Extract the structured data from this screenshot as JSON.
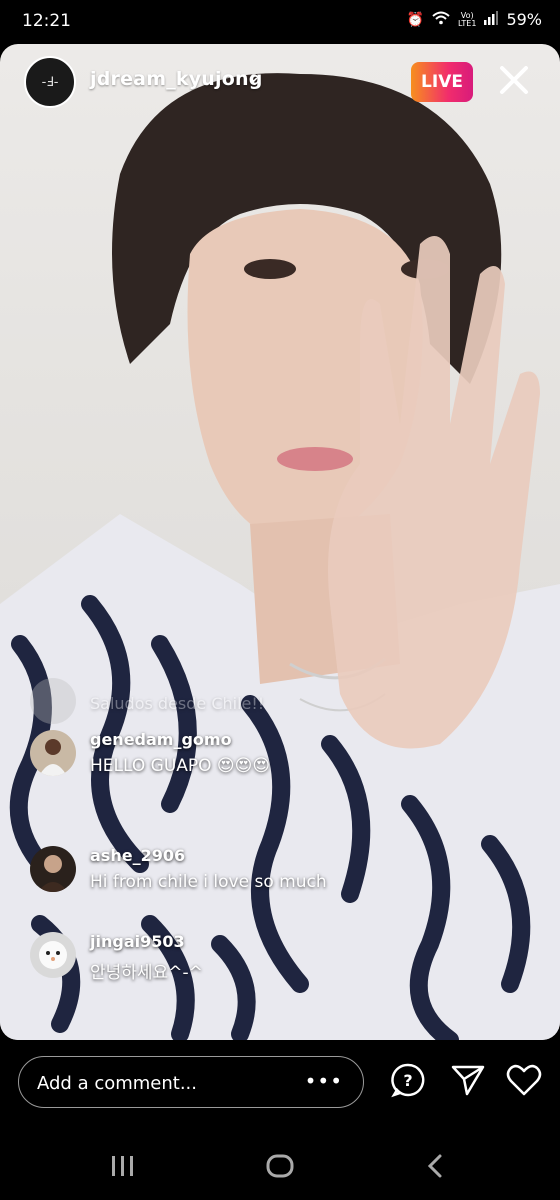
{
  "status_bar": {
    "time": "12:21",
    "network_label_top": "Vo)",
    "network_label_bottom": "LTE1",
    "battery": "59%"
  },
  "live": {
    "host_username": "jdream_kyujong",
    "badge": "LIVE"
  },
  "comments": [
    {
      "username": "",
      "text": "Saludos desde Chile!!",
      "faded": true
    },
    {
      "username": "genedam_gomo",
      "text": "HELLO GUAPO 😍😍😍"
    },
    {
      "username": "ashe_2906",
      "text": "Hi from chile i love so much"
    },
    {
      "username": "jingai9503",
      "text": "안녕하세요^-^"
    }
  ],
  "bottom_bar": {
    "comment_placeholder": "Add a comment...",
    "more_label": "•••"
  },
  "icons": {
    "close": "close-icon",
    "question": "question-icon",
    "send": "send-icon",
    "heart": "heart-icon",
    "chevron": "chevron-down-icon"
  }
}
